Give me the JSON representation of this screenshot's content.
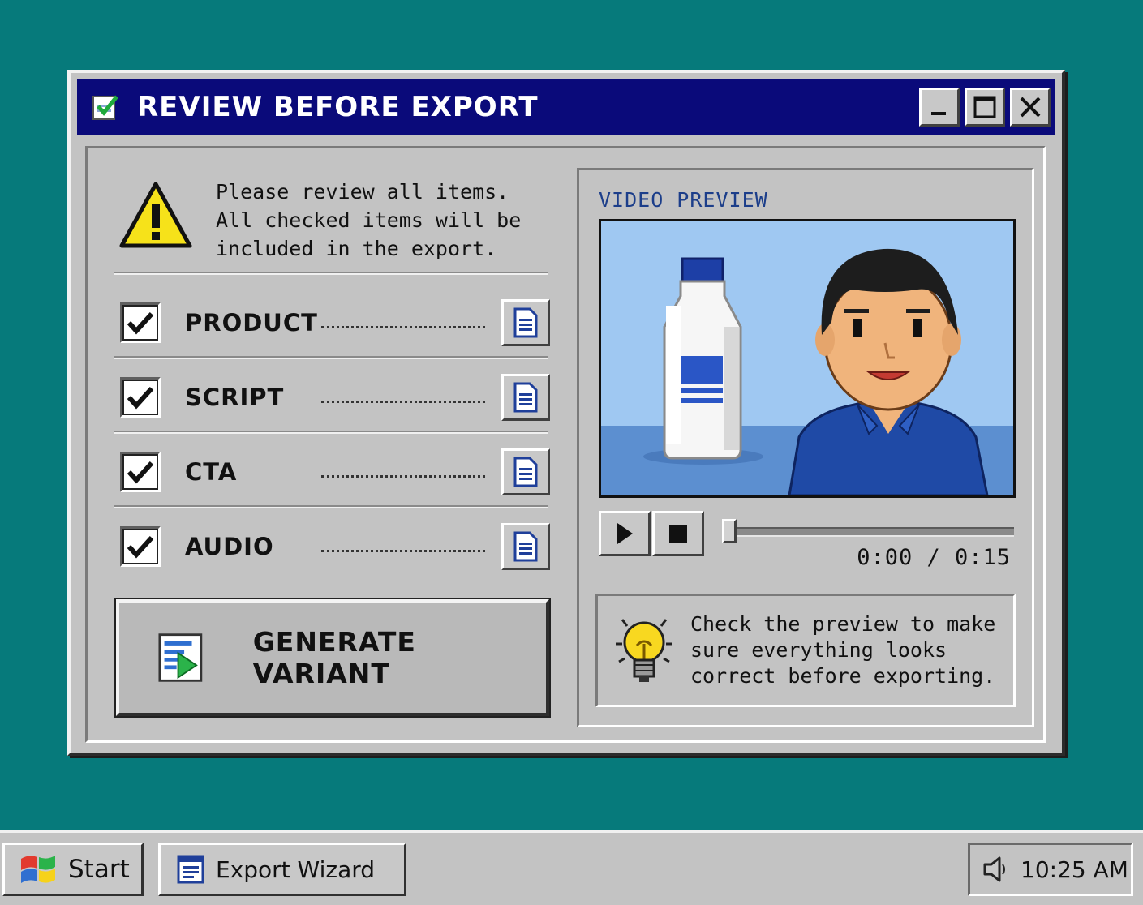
{
  "window": {
    "title": "REVIEW BEFORE EXPORT",
    "title_icon": "checklist-icon",
    "controls": [
      "minimize-icon",
      "maximize-icon",
      "close-icon"
    ]
  },
  "warning": {
    "icon": "warning-icon",
    "lines": [
      "Please review all items.",
      "All checked items will be",
      "included in the export."
    ]
  },
  "items": [
    {
      "label": "PRODUCT",
      "checked": true
    },
    {
      "label": "SCRIPT",
      "checked": true
    },
    {
      "label": "CTA",
      "checked": true
    },
    {
      "label": "AUDIO",
      "checked": true
    }
  ],
  "generate_button": {
    "label": "GENERATE VARIANT",
    "icon": "generate-icon"
  },
  "preview": {
    "label": "VIDEO PREVIEW",
    "time": "0:00 / 0:15",
    "progress": 0
  },
  "tip": {
    "icon": "lightbulb-icon",
    "lines": [
      "Check the preview to make",
      "sure everything looks",
      "correct before exporting."
    ]
  },
  "taskbar": {
    "start_label": "Start",
    "task_label": "Export Wizard",
    "clock": "10:25 AM"
  },
  "colors": {
    "desktop": "#067a7b",
    "titlebar": "#0a0a7a",
    "face": "#c3c3c3",
    "accent_text": "#1c3e8a"
  }
}
